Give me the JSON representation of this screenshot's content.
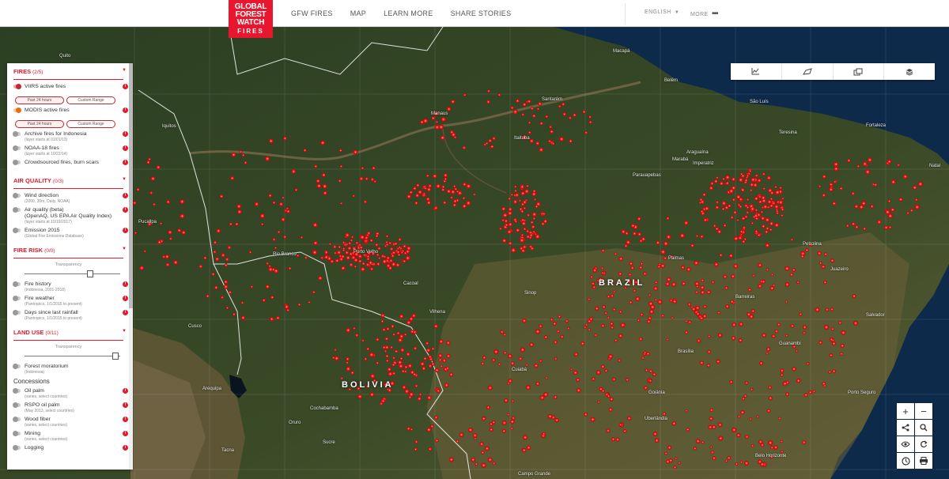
{
  "header": {
    "logo": [
      "GLOBAL",
      "FOREST",
      "WATCH",
      "FIRES"
    ],
    "nav": [
      "GFW FIRES",
      "MAP",
      "LEARN MORE",
      "SHARE STORIES"
    ],
    "language": "ENGLISH",
    "more": "MORE"
  },
  "map": {
    "country_labels": {
      "brazil": "BRAZIL",
      "bolivia": "BOLIVIA"
    },
    "cities": [
      {
        "name": "Quito"
      },
      {
        "name": "Iquitos"
      },
      {
        "name": "Manaus"
      },
      {
        "name": "Santarém"
      },
      {
        "name": "Macapá"
      },
      {
        "name": "Belém"
      },
      {
        "name": "São Luís"
      },
      {
        "name": "Fortaleza"
      },
      {
        "name": "Teresina"
      },
      {
        "name": "Itaituba"
      },
      {
        "name": "Marabá"
      },
      {
        "name": "Imperatriz"
      },
      {
        "name": "Araguaína"
      },
      {
        "name": "Parauapebas"
      },
      {
        "name": "Natal"
      },
      {
        "name": "Petrolina"
      },
      {
        "name": "Porto Velho"
      },
      {
        "name": "Rio Branco"
      },
      {
        "name": "Pucallpa"
      },
      {
        "name": "Cacoal"
      },
      {
        "name": "Vilhena"
      },
      {
        "name": "Sinop"
      },
      {
        "name": "Palmas"
      },
      {
        "name": "Barreiras"
      },
      {
        "name": "Salvador"
      },
      {
        "name": "Cusco"
      },
      {
        "name": "Arequipa"
      },
      {
        "name": "Cuiabá"
      },
      {
        "name": "Brasília"
      },
      {
        "name": "Goiânia"
      },
      {
        "name": "Cochabamba"
      },
      {
        "name": "Sucre"
      },
      {
        "name": "Uberlândia"
      },
      {
        "name": "Porto Seguro"
      },
      {
        "name": "Belo Horizonte"
      },
      {
        "name": "Campo Grande"
      },
      {
        "name": "Oruro"
      },
      {
        "name": "Juazeiro"
      },
      {
        "name": "Guanambi"
      },
      {
        "name": "Tacna"
      }
    ],
    "scale": "300km"
  },
  "panel": {
    "fires": {
      "title": "FIRES",
      "count": "(2/5)",
      "layers": [
        {
          "name": "VIIRS active fires",
          "sub": "",
          "on": true,
          "color": "#c1272d"
        },
        {
          "name": "MODIS active fires",
          "sub": "",
          "on": true,
          "color": "#e56d15"
        },
        {
          "name": "Archive fires for Indonesia",
          "sub": "(layer starts at 01/01/13)",
          "on": false
        },
        {
          "name": "NOAA-18 fires",
          "sub": "(layer starts at 10/22/14)",
          "on": false
        },
        {
          "name": "Crowdsourced fires, burn scars",
          "sub": "",
          "on": false
        }
      ],
      "range_buttons": [
        "Past 24 hours",
        "Custom Range"
      ]
    },
    "air_quality": {
      "title": "AIR QUALITY",
      "count": "(0/3)",
      "layers": [
        {
          "name": "Wind direction",
          "sub": "(2000, 30m, Daily, NOAA)"
        },
        {
          "name": "Air quality (beta)",
          "name2": "(OpenAQ, US EPA Air Quality Index)",
          "sub": "(layer starts at 10/19/2017)"
        },
        {
          "name": "Emission 2015",
          "sub": "(Global Fire Emissions Database)"
        }
      ]
    },
    "fire_risk": {
      "title": "FIRE RISK",
      "count": "(0/0)",
      "transparency": "Transparency",
      "transparency_level": 0.72,
      "layers": [
        {
          "name": "Fire history",
          "sub": "(Indonesia, 2001-2018)"
        },
        {
          "name": "Fire weather",
          "sub": "(Pantropics, 1/1/2015 to present)"
        },
        {
          "name": "Days since last rainfall",
          "sub": "(Pantropics, 1/1/2015 to present)"
        }
      ]
    },
    "land_use": {
      "title": "LAND USE",
      "count": "(0/11)",
      "transparency": "Transparency",
      "transparency_level": 0.98,
      "layers": [
        {
          "name": "Forest moratorium",
          "sub": "(Indonesia)"
        }
      ],
      "concessions_label": "Concessions",
      "concessions": [
        {
          "name": "Oil palm",
          "sub": "(varies, select countries)"
        },
        {
          "name": "RSPO oil palm",
          "sub": "(May 2013, select countries)"
        },
        {
          "name": "Wood fiber",
          "sub": "(varies, select countries)"
        },
        {
          "name": "Mining",
          "sub": "(varies, select countries)"
        },
        {
          "name": "Logging",
          "sub": ""
        }
      ]
    }
  },
  "toolbar": {
    "icons": [
      "chart-icon",
      "draw-shape-icon",
      "basemap-icon",
      "layers-icon"
    ]
  },
  "controls": {
    "icons": [
      "zoom-in-icon",
      "zoom-out-icon",
      "share-icon",
      "search-icon",
      "eye-icon",
      "refresh-icon",
      "clock-icon",
      "print-icon"
    ]
  },
  "colors": {
    "accent": "#e31a2d",
    "fire": "#ff1a1a",
    "ocean": "#0e2a4a",
    "forest": "#24361d"
  }
}
